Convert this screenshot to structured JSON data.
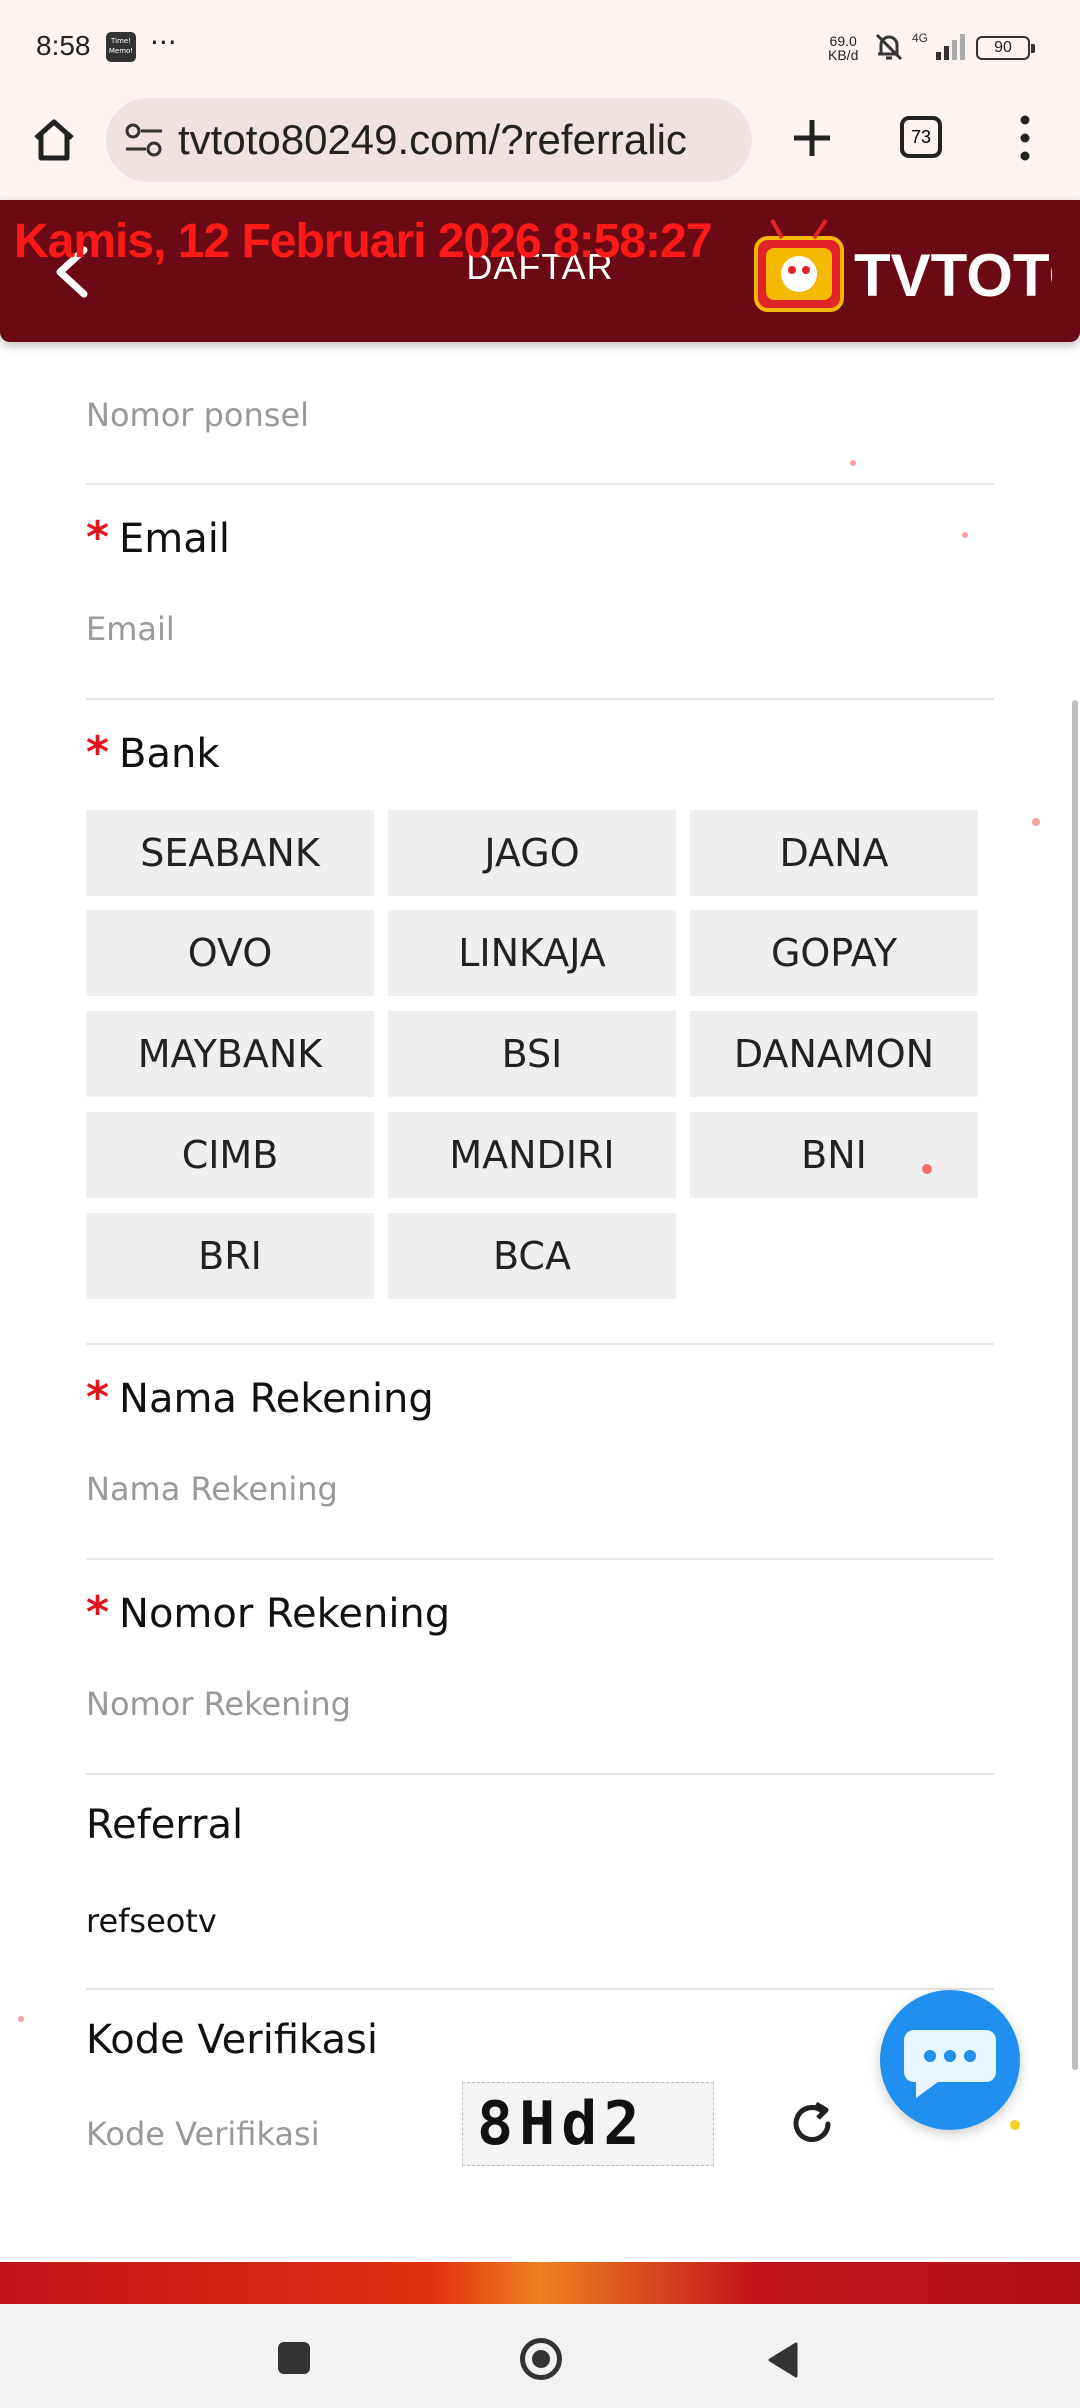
{
  "status": {
    "time": "8:58",
    "memo": "Time! Memo!",
    "more": "···",
    "speed_value": "69.0",
    "speed_unit": "KB/d",
    "network": "4G",
    "battery": "90"
  },
  "browser": {
    "url": "tvtoto80249.com/?referralic",
    "tab_count": "73"
  },
  "header": {
    "datetime": "Kamis, 12 Februari 2026 8:58:27",
    "title": "DAFTAR",
    "logo_text": "TVTOTO"
  },
  "form": {
    "phone": {
      "placeholder": "Nomor ponsel"
    },
    "email": {
      "label": "Email",
      "placeholder": "Email"
    },
    "bank": {
      "label": "Bank",
      "options": [
        "SEABANK",
        "JAGO",
        "DANA",
        "OVO",
        "LINKAJA",
        "GOPAY",
        "MAYBANK",
        "BSI",
        "DANAMON",
        "CIMB",
        "MANDIRI",
        "BNI",
        "BRI",
        "BCA"
      ]
    },
    "account_name": {
      "label": "Nama Rekening",
      "placeholder": "Nama Rekening"
    },
    "account_number": {
      "label": "Nomor Rekening",
      "placeholder": "Nomor Rekening"
    },
    "referral": {
      "label": "Referral",
      "value": "refseotv"
    },
    "verification": {
      "label": "Kode Verifikasi",
      "placeholder": "Kode Verifikasi",
      "captcha": "8Hd2"
    },
    "required_mark": "*"
  },
  "colors": {
    "header_bg": "#6b0a14",
    "required": "#e4141f",
    "chat": "#1f90f0"
  },
  "icons": [
    "home-icon",
    "tune-icon",
    "plus-icon",
    "tabs-icon",
    "menu-icon",
    "back-icon",
    "refresh-icon",
    "chat-icon"
  ]
}
